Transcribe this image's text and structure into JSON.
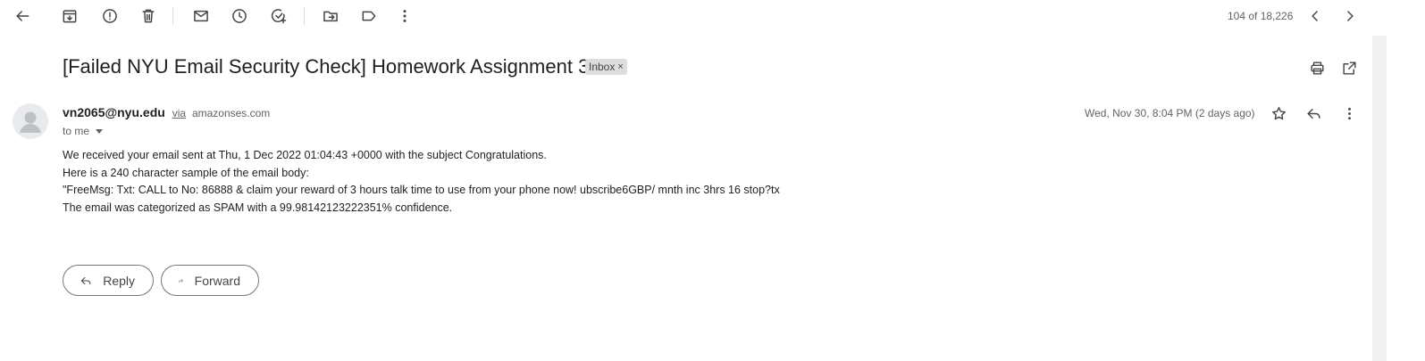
{
  "toolbar": {
    "icons": [
      "back-arrow-icon",
      "archive-icon",
      "report-spam-icon",
      "delete-icon",
      "mark-unread-icon",
      "snooze-icon",
      "add-task-icon",
      "move-to-icon",
      "label-icon",
      "more-vert-icon"
    ],
    "counter": "104 of 18,226"
  },
  "email": {
    "subject": "[Failed NYU Email Security Check] Homework Assignment 3",
    "label": "Inbox",
    "label_close": "×",
    "sender_email": "vn2065@nyu.edu",
    "via": "via",
    "via_domain": "amazonses.com",
    "recipient": "to me",
    "date": "Wed, Nov 30, 8:04 PM (2 days ago)",
    "body": [
      "We received your email sent at Thu, 1 Dec 2022 01:04:43 +0000 with the subject Congratulations.",
      "Here is a 240 character sample of the email body:",
      "\"FreeMsg: Txt: CALL to No: 86888 & claim your reward of 3 hours talk time to use from your phone now! ubscribe6GBP/ mnth inc 3hrs 16 stop?tx",
      "The email was categorized as SPAM with a 99.98142123222351% confidence."
    ]
  },
  "actions": {
    "reply": "Reply",
    "forward": "Forward"
  },
  "colors": {
    "text": "#202124",
    "muted": "#5f6368",
    "icon": "#444746",
    "chip": "#dddddd"
  }
}
